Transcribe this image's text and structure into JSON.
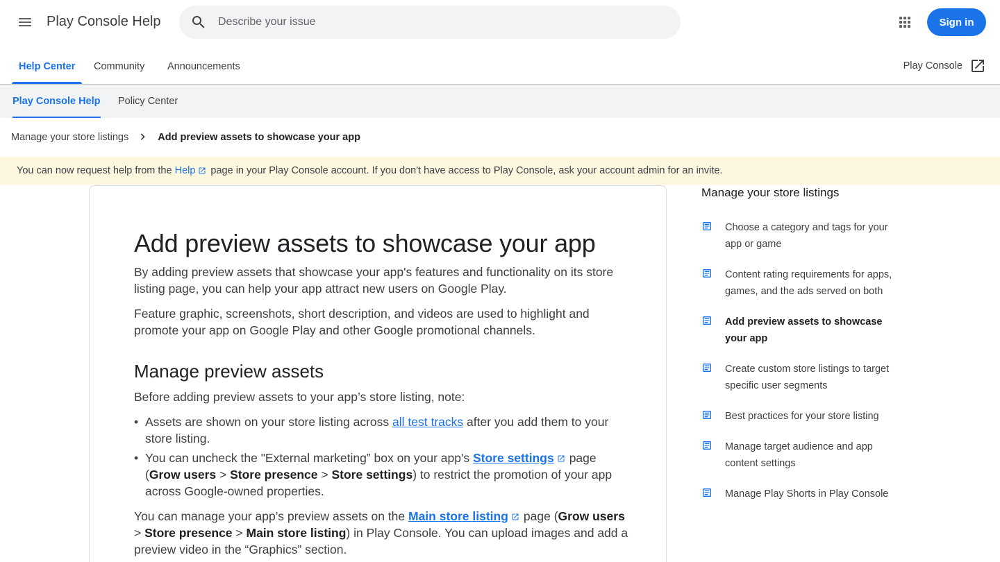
{
  "header": {
    "app_title": "Play Console Help",
    "search_placeholder": "Describe your issue",
    "sign_in_label": "Sign in"
  },
  "tabs": {
    "items": [
      {
        "label": "Help Center",
        "active": true
      },
      {
        "label": "Community",
        "active": false
      },
      {
        "label": "Announcements",
        "active": false
      }
    ],
    "play_console_link": "Play Console"
  },
  "subnav": {
    "items": [
      {
        "label": "Play Console Help",
        "active": true
      },
      {
        "label": "Policy Center",
        "active": false
      }
    ]
  },
  "breadcrumb": {
    "parent": "Manage your store listings",
    "current": "Add preview assets to showcase your app"
  },
  "banner": {
    "prefix": "You can now request help from the",
    "link": "Help",
    "suffix": "page in your Play Console account.  If you don't have access to Play Console, ask your account admin for an invite."
  },
  "article": {
    "title": "Add preview assets to showcase your app",
    "intro1": "By adding preview assets that showcase your app's features and functionality on its store listing page, you can help your app attract new users on Google Play.",
    "intro2": "Feature graphic, screenshots, short description, and videos are used to highlight and promote your app on Google Play and other Google promotional channels.",
    "section_title": "Manage preview assets",
    "section_intro": "Before adding preview assets to your app’s store listing, note:",
    "bullet1": {
      "before": "Assets are shown on your store listing across",
      "link": "all test tracks",
      "after": "after you add them to your store listing."
    },
    "bullet2": {
      "before": "You can uncheck the \"External marketing” box on your app's",
      "link": "Store settings",
      "page_open": "page (",
      "b1": "Grow users",
      "sep1": " > ",
      "b2": "Store presence",
      "sep2": " > ",
      "b3": "Store settings",
      "after": ") to restrict the promotion of your app across Google-owned properties."
    },
    "para3": {
      "before": "You can manage your app’s preview assets on the",
      "link": "Main store listing",
      "page_open": "page (",
      "b1": "Grow users",
      "sep1": " > ",
      "b2": "Store presence",
      "sep2": " > ",
      "b3": "Main store listing",
      "after": ") in Play Console. You can upload images and add a preview video in the “Graphics” section."
    }
  },
  "sidebar": {
    "title": "Manage your store listings",
    "items": [
      {
        "label": "Choose a category and tags for your app or game",
        "current": false
      },
      {
        "label": "Content rating requirements for apps, games, and the ads served on both",
        "current": false
      },
      {
        "label": "Add preview assets to showcase your app",
        "current": true
      },
      {
        "label": "Create custom store listings to target specific user segments",
        "current": false
      },
      {
        "label": "Best practices for your store listing",
        "current": false
      },
      {
        "label": "Manage target audience and app content settings",
        "current": false
      },
      {
        "label": "Manage Play Shorts in Play Console",
        "current": false
      }
    ]
  },
  "colors": {
    "accent": "#1a73e8",
    "banner_bg": "#fef7e0",
    "subnav_bg": "#f1f3f4"
  }
}
